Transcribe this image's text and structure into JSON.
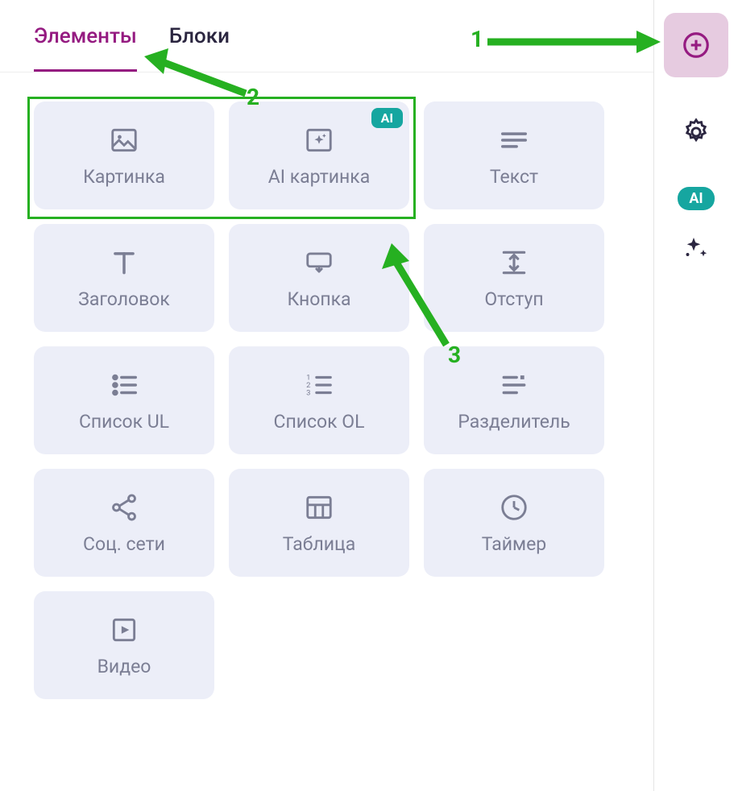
{
  "tabs": {
    "elements": "Элементы",
    "blocks": "Блоки"
  },
  "ai_badge": "AI",
  "elements": [
    {
      "label": "Картинка",
      "name": "image-element",
      "icon": "image"
    },
    {
      "label": "AI картинка",
      "name": "ai-image-element",
      "icon": "ai-image",
      "ai": true
    },
    {
      "label": "Текст",
      "name": "text-element",
      "icon": "text"
    },
    {
      "label": "Заголовок",
      "name": "heading-element",
      "icon": "heading"
    },
    {
      "label": "Кнопка",
      "name": "button-element",
      "icon": "button"
    },
    {
      "label": "Отступ",
      "name": "spacer-element",
      "icon": "spacer"
    },
    {
      "label": "Список UL",
      "name": "ul-list-element",
      "icon": "ul"
    },
    {
      "label": "Список OL",
      "name": "ol-list-element",
      "icon": "ol"
    },
    {
      "label": "Разделитель",
      "name": "divider-element",
      "icon": "divider"
    },
    {
      "label": "Соц. сети",
      "name": "social-element",
      "icon": "share"
    },
    {
      "label": "Таблица",
      "name": "table-element",
      "icon": "table"
    },
    {
      "label": "Таймер",
      "name": "timer-element",
      "icon": "clock"
    },
    {
      "label": "Видео",
      "name": "video-element",
      "icon": "video"
    }
  ],
  "rail": {
    "ai_label": "AI"
  },
  "annotations": {
    "a1": "1",
    "a2": "2",
    "a3": "3"
  }
}
